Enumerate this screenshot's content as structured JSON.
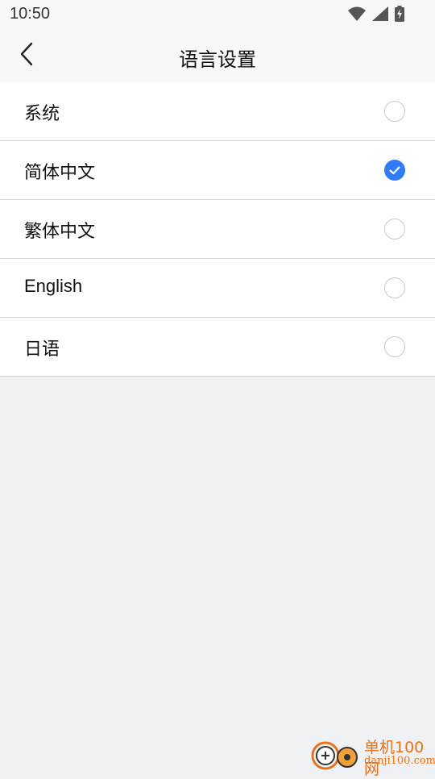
{
  "status_bar": {
    "time": "10:50",
    "icons": [
      "wifi-icon",
      "signal-icon",
      "battery-charging-icon"
    ]
  },
  "header": {
    "title": "语言设置",
    "back_icon": "chevron-left-icon"
  },
  "languages": [
    {
      "label": "系统",
      "selected": false
    },
    {
      "label": "简体中文",
      "selected": true
    },
    {
      "label": "繁体中文",
      "selected": false
    },
    {
      "label": "English",
      "selected": false
    },
    {
      "label": "日语",
      "selected": false
    }
  ],
  "colors": {
    "accent": "#2f7cf6",
    "background": "#f0f1f5",
    "watermark": "#e8711a"
  },
  "watermark": {
    "name": "单机100网",
    "domain": "danji100.com"
  }
}
